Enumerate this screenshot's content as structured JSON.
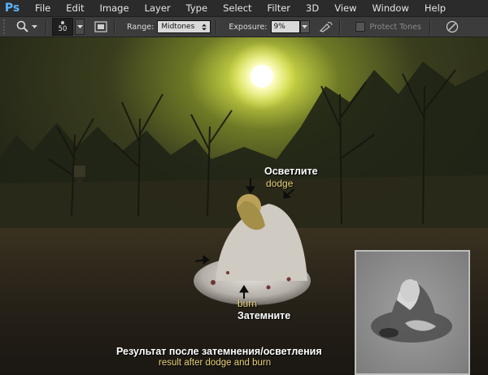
{
  "app": {
    "logo_text": "Ps"
  },
  "menu": [
    "File",
    "Edit",
    "Image",
    "Layer",
    "Type",
    "Select",
    "Filter",
    "3D",
    "View",
    "Window",
    "Help"
  ],
  "options": {
    "brush_size": "50",
    "range_label": "Range:",
    "range_value": "Midtones",
    "exposure_label": "Exposure:",
    "exposure_value": "9%",
    "protect_tones_label": "Protect Tones"
  },
  "canvas": {
    "dodge_ru": "Осветлите",
    "dodge_en": "dodge",
    "burn_en": "burn",
    "burn_ru": "Затемните",
    "result_ru": "Результат после затемнения/осветления",
    "result_en": "result after dodge and burn"
  },
  "colors": {
    "accent_text": "#e7d27a",
    "white_text": "#ffffff",
    "ps_blue": "#5ab4ff"
  }
}
